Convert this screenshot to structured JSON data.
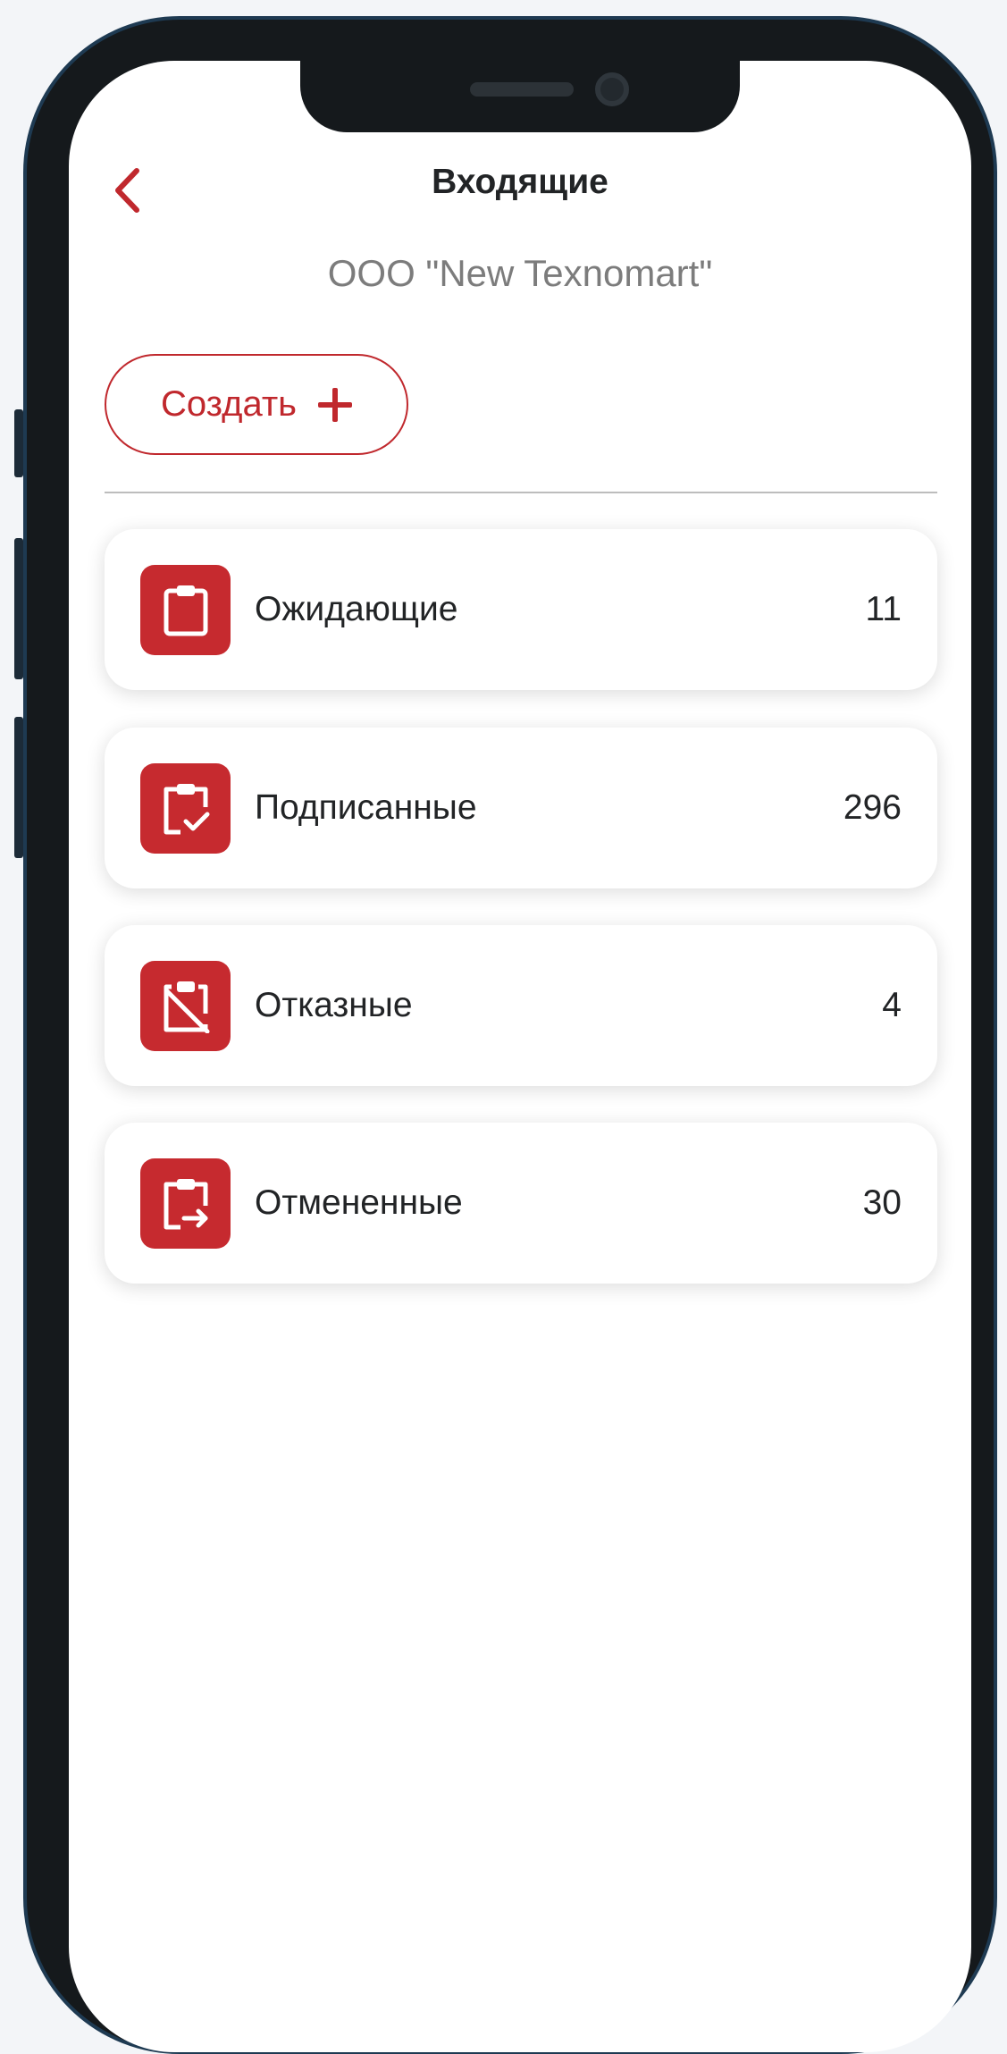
{
  "header": {
    "title": "Входящие",
    "subtitle": "ООО \"New Texnomart\""
  },
  "actions": {
    "create_label": "Создать"
  },
  "accent_color": "#c62a2f",
  "categories": [
    {
      "label": "Ожидающие",
      "count": "11",
      "icon": "clipboard-icon"
    },
    {
      "label": "Подписанные",
      "count": "296",
      "icon": "clipboard-check-icon"
    },
    {
      "label": "Отказные",
      "count": "4",
      "icon": "clipboard-off-icon"
    },
    {
      "label": "Отмененные",
      "count": "30",
      "icon": "clipboard-export-icon"
    }
  ]
}
